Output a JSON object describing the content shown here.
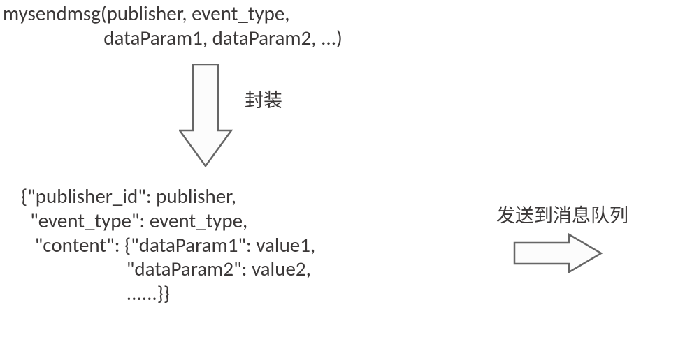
{
  "function_call": {
    "line1": "mysendmsg(publisher, event_type,",
    "line2": "                      dataParam1, dataParam2, ...)"
  },
  "encapsulate_label": "封装",
  "json_output": {
    "line1": "{\"publisher_id\": publisher,",
    "line2": "  \"event_type\": event_type,",
    "line3": "   \"content\": {\"dataParam1\": value1,",
    "line4": "                       \"dataParam2\": value2,",
    "line5": "                       ......}}"
  },
  "send_label": "发送到消息队列"
}
